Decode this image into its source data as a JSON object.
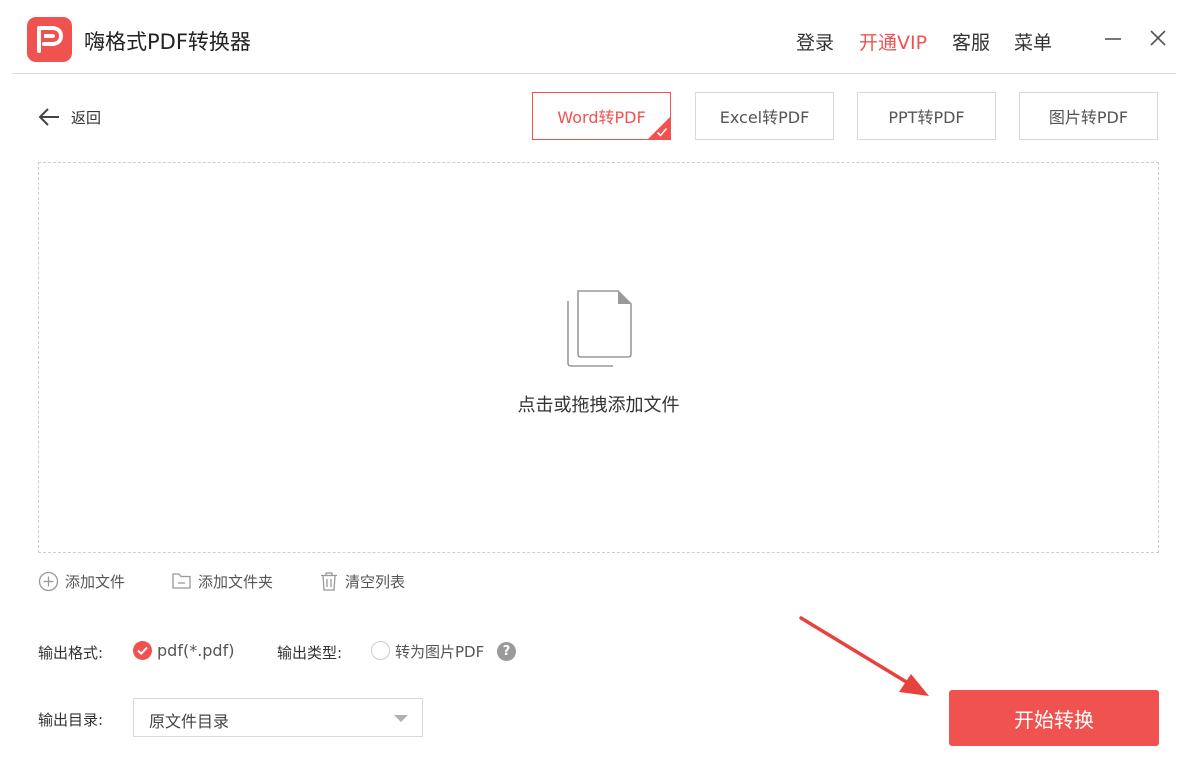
{
  "app": {
    "title": "嗨格式PDF转换器",
    "brand_color": "#f0524f",
    "logo_icon": "pdf-logo-icon"
  },
  "top_menu": {
    "login": "登录",
    "vip": "开通VIP",
    "service": "客服",
    "menu": "菜单"
  },
  "window_controls": [
    "minimize-icon",
    "close-icon"
  ],
  "back": {
    "label": "返回",
    "icon": "arrow-left-icon"
  },
  "tabs": [
    {
      "label": "Word转PDF",
      "active": true
    },
    {
      "label": "Excel转PDF",
      "active": false
    },
    {
      "label": "PPT转PDF",
      "active": false
    },
    {
      "label": "图片转PDF",
      "active": false
    }
  ],
  "dropzone": {
    "icon": "file-copy-icon",
    "text": "点击或拖拽添加文件"
  },
  "file_actions": [
    {
      "label": "添加文件",
      "icon": "plus-circle-icon"
    },
    {
      "label": "添加文件夹",
      "icon": "folder-icon"
    },
    {
      "label": "清空列表",
      "icon": "trash-icon"
    }
  ],
  "output": {
    "format_label": "输出格式:",
    "format_value": "pdf(*.pdf)",
    "type_label": "输出类型:",
    "type_value": "转为图片PDF",
    "help": "?",
    "dir_label": "输出目录:",
    "dir_value": "原文件目录"
  },
  "start_button": "开始转换"
}
